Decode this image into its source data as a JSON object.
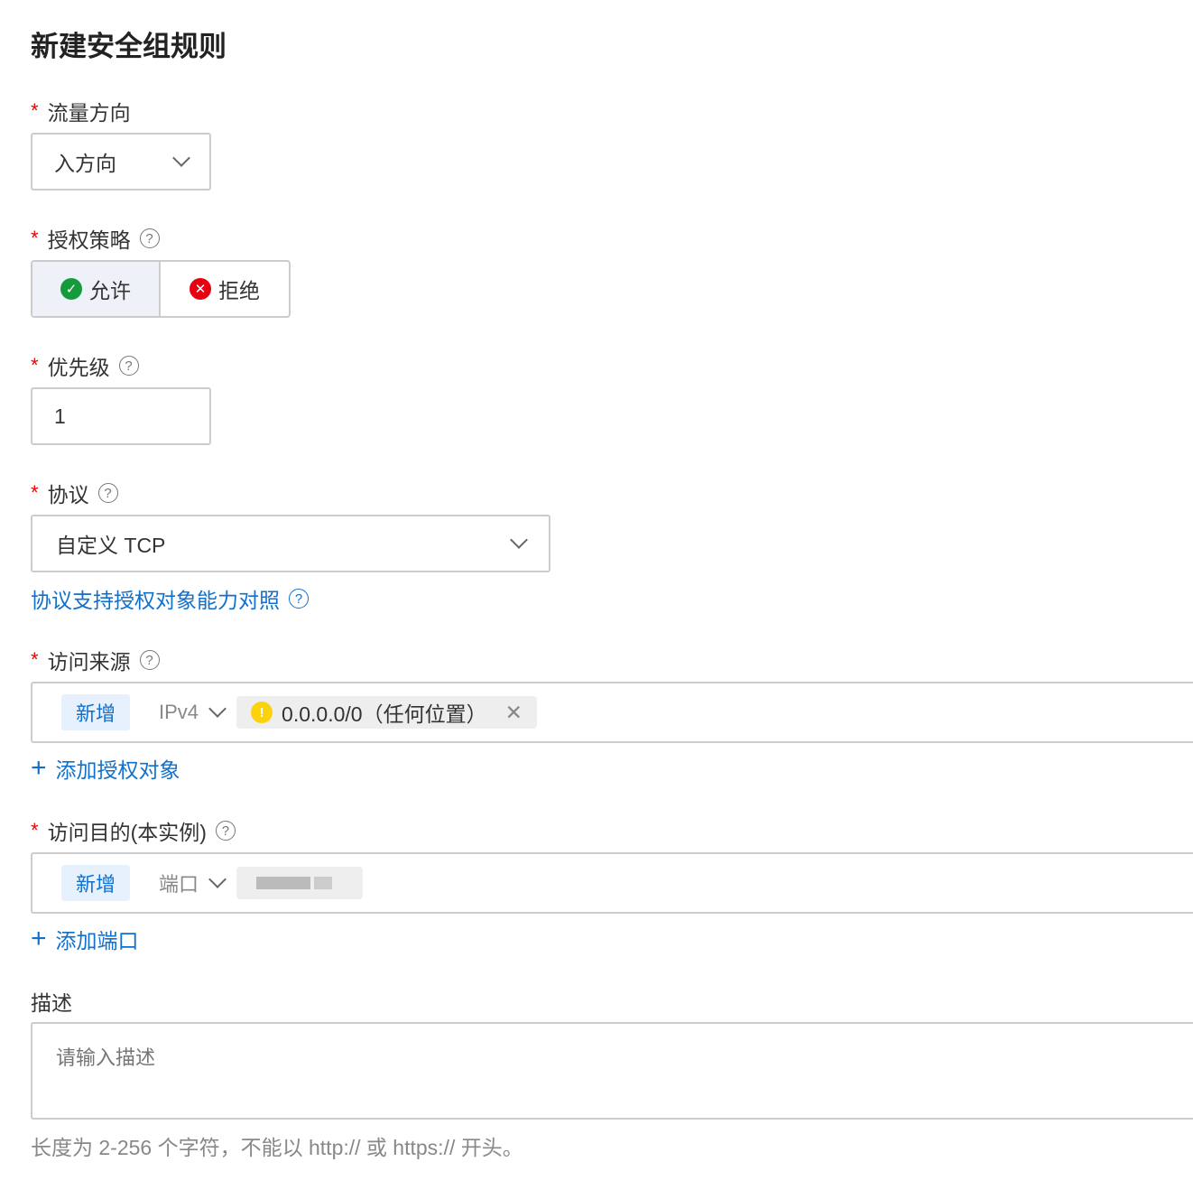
{
  "title": "新建安全组规则",
  "direction": {
    "label": "流量方向",
    "value": "入方向"
  },
  "policy": {
    "label": "授权策略",
    "allow": "允许",
    "deny": "拒绝",
    "selected": "允许"
  },
  "priority": {
    "label": "优先级",
    "value": "1"
  },
  "protocol": {
    "label": "协议",
    "value": "自定义 TCP",
    "link": "协议支持授权对象能力对照"
  },
  "source": {
    "label": "访问来源",
    "tag": "新增",
    "type": "IPv4",
    "item": "0.0.0.0/0（任何位置）",
    "add": "添加授权对象"
  },
  "dest": {
    "label": "访问目的(本实例)",
    "tag": "新增",
    "type": "端口",
    "add": "添加端口"
  },
  "desc": {
    "label": "描述",
    "placeholder": "请输入描述",
    "hint": "长度为 2-256 个字符，不能以 http:// 或 https:// 开头。"
  },
  "help_glyph": "?"
}
